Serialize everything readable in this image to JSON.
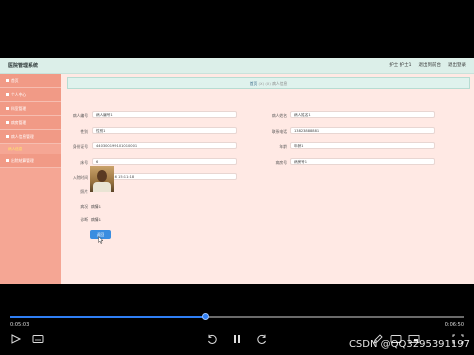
{
  "app": {
    "title": "医院管理系统",
    "header_links": [
      "护士 护士1",
      "退出到前台",
      "退出登录"
    ]
  },
  "sidebar": {
    "items": [
      {
        "label": "首页"
      },
      {
        "label": "个人中心"
      },
      {
        "label": "科室管理"
      },
      {
        "label": "病房管理"
      },
      {
        "label": "病人信息管理"
      },
      {
        "label": "病人信息"
      },
      {
        "label": "出院结算管理"
      }
    ],
    "active_sub": "病人信息"
  },
  "breadcrumb": {
    "home": "首页",
    "sep1": "(X)",
    "mid": "(X)",
    "current": "病人信息"
  },
  "form": {
    "fields_left": [
      {
        "label": "病人编号",
        "value": "病人编号1"
      },
      {
        "label": "性别",
        "value": "性别1"
      },
      {
        "label": "身份证号",
        "value": "440300199101010001"
      },
      {
        "label": "床号",
        "value": "6"
      },
      {
        "label": "入院时间",
        "value": "2021-04-16 15:11:18"
      }
    ],
    "fields_right": [
      {
        "label": "病人姓名",
        "value": "病人姓名1"
      },
      {
        "label": "联系电话",
        "value": "13823888881"
      },
      {
        "label": "年龄",
        "value": "年龄1"
      },
      {
        "label": "病房号",
        "value": "病房号1"
      }
    ],
    "photo_label": "照片",
    "status_label": "病况",
    "status_value": "病情1",
    "diag_label": "诊断",
    "diag_value": "病情1",
    "back_button": "返回"
  },
  "player": {
    "current_time": "0:05:03",
    "total_time": "0:06:50",
    "progress_fraction": 0.43,
    "watermark": "CSDN @QQ3295391197"
  }
}
